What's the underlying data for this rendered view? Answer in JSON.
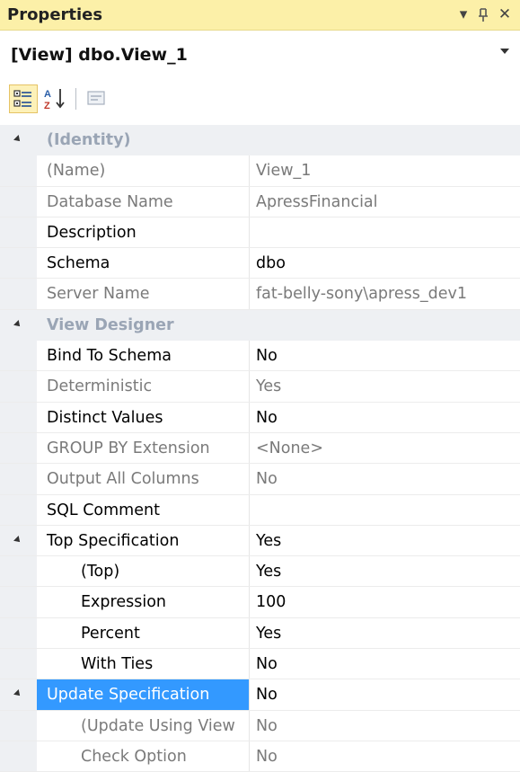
{
  "window": {
    "title": "Properties"
  },
  "object_selector": {
    "value": "[View] dbo.View_1"
  },
  "toolbar": {
    "categorized_active": true
  },
  "categories": [
    {
      "name": "(Identity)",
      "rows": [
        {
          "name": "(Name)",
          "value": "View_1",
          "readonly": true,
          "indent": false
        },
        {
          "name": "Database Name",
          "value": "ApressFinancial",
          "readonly": true,
          "indent": false
        },
        {
          "name": "Description",
          "value": "",
          "readonly": false,
          "indent": false
        },
        {
          "name": "Schema",
          "value": "dbo",
          "readonly": false,
          "indent": false
        },
        {
          "name": "Server Name",
          "value": "fat-belly-sony\\apress_dev1",
          "readonly": true,
          "indent": false
        }
      ]
    },
    {
      "name": "View Designer",
      "rows": [
        {
          "name": "Bind To Schema",
          "value": "No",
          "readonly": false,
          "indent": false
        },
        {
          "name": "Deterministic",
          "value": "Yes",
          "readonly": true,
          "indent": false
        },
        {
          "name": "Distinct Values",
          "value": "No",
          "readonly": false,
          "indent": false
        },
        {
          "name": "GROUP BY Extension",
          "value": "<None>",
          "readonly": true,
          "indent": false
        },
        {
          "name": "Output All Columns",
          "value": "No",
          "readonly": true,
          "indent": false
        },
        {
          "name": "SQL Comment",
          "value": "",
          "readonly": false,
          "indent": false
        },
        {
          "name": "Top Specification",
          "value": "Yes",
          "readonly": false,
          "indent": false,
          "expandable": true
        },
        {
          "name": "(Top)",
          "value": "Yes",
          "readonly": false,
          "indent": true
        },
        {
          "name": "Expression",
          "value": "100",
          "readonly": false,
          "indent": true
        },
        {
          "name": "Percent",
          "value": "Yes",
          "readonly": false,
          "indent": true
        },
        {
          "name": "With Ties",
          "value": "No",
          "readonly": false,
          "indent": true
        },
        {
          "name": "Update Specification",
          "value": "No",
          "readonly": false,
          "indent": false,
          "expandable": true,
          "selected": true
        },
        {
          "name": "(Update Using View",
          "value": "No",
          "readonly": true,
          "indent": true
        },
        {
          "name": "Check Option",
          "value": "No",
          "readonly": true,
          "indent": true
        }
      ]
    }
  ]
}
